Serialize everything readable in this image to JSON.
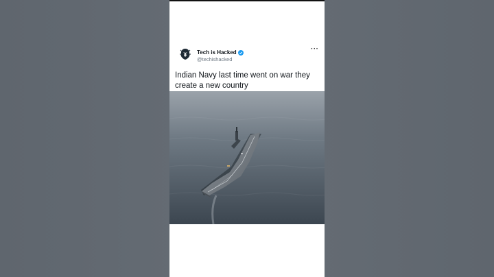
{
  "post": {
    "display_name": "Tech is Hacked",
    "handle": "@techishacked",
    "text": "Indian Navy last time went on war they create a new country",
    "more_icon": "more-horizontal-icon",
    "verified_icon": "verified-badge-icon",
    "media_subject": "aircraft-carrier-at-sea"
  },
  "colors": {
    "background": "#636a72",
    "card": "#ffffff",
    "verified": "#1d9bf0",
    "text": "#0f1419",
    "subtext": "#6b7680"
  }
}
